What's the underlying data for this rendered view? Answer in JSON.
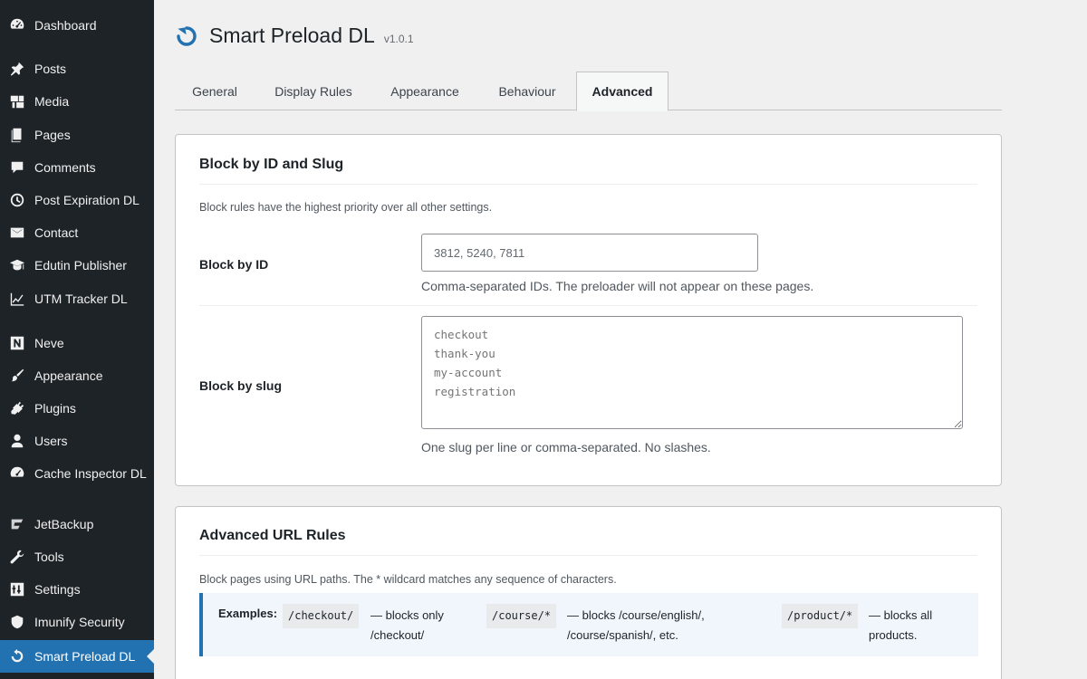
{
  "sidebar": {
    "items": [
      {
        "label": "Dashboard",
        "icon": "dashboard-icon"
      },
      {
        "label": "Posts",
        "icon": "pin-icon"
      },
      {
        "label": "Media",
        "icon": "media-icon"
      },
      {
        "label": "Pages",
        "icon": "pages-icon"
      },
      {
        "label": "Comments",
        "icon": "comment-icon"
      },
      {
        "label": "Post Expiration DL",
        "icon": "clock-icon"
      },
      {
        "label": "Contact",
        "icon": "envelope-icon"
      },
      {
        "label": "Edutin Publisher",
        "icon": "graduation-cap-icon"
      },
      {
        "label": "UTM Tracker DL",
        "icon": "chart-line-icon"
      },
      {
        "label": "Neve",
        "icon": "neve-logo-icon"
      },
      {
        "label": "Appearance",
        "icon": "brush-icon"
      },
      {
        "label": "Plugins",
        "icon": "plug-icon"
      },
      {
        "label": "Users",
        "icon": "user-icon"
      },
      {
        "label": "Cache Inspector DL",
        "icon": "gauge-icon"
      },
      {
        "label": "JetBackup",
        "icon": "jetbackup-icon"
      },
      {
        "label": "Tools",
        "icon": "wrench-icon"
      },
      {
        "label": "Settings",
        "icon": "sliders-icon"
      },
      {
        "label": "Imunify Security",
        "icon": "shield-icon"
      },
      {
        "label": "Smart Preload DL",
        "icon": "refresh-icon",
        "current": true
      }
    ]
  },
  "header": {
    "title": "Smart Preload DL",
    "version": "v1.0.1",
    "logo_icon": "refresh-icon"
  },
  "tabs": [
    {
      "label": "General"
    },
    {
      "label": "Display Rules"
    },
    {
      "label": "Appearance"
    },
    {
      "label": "Behaviour"
    },
    {
      "label": "Advanced",
      "active": true
    }
  ],
  "block_card": {
    "title": "Block by ID and Slug",
    "description": "Block rules have the highest priority over all other settings.",
    "id_field": {
      "label": "Block by ID",
      "placeholder": "3812, 5240, 7811",
      "help": "Comma-separated IDs. The preloader will not appear on these pages."
    },
    "slug_field": {
      "label": "Block by slug",
      "placeholder": "checkout\nthank-you\nmy-account\nregistration",
      "help": "One slug per line or comma-separated. No slashes."
    }
  },
  "url_card": {
    "title": "Advanced URL Rules",
    "description": "Block pages using URL paths. The * wildcard matches any sequence of characters.",
    "examples_label": "Examples:",
    "examples": [
      {
        "code": "/checkout/",
        "line1": "— blocks only",
        "line2": "/checkout/"
      },
      {
        "code": "/course/*",
        "line1": "— blocks /course/english/,",
        "line2": "/course/spanish/, etc."
      },
      {
        "code": "/product/*",
        "line1": "— blocks all",
        "line2": "products."
      }
    ]
  },
  "colors": {
    "sidebar_bg": "#1d2327",
    "accent": "#2271b1",
    "page_bg": "#f0f0f1"
  }
}
